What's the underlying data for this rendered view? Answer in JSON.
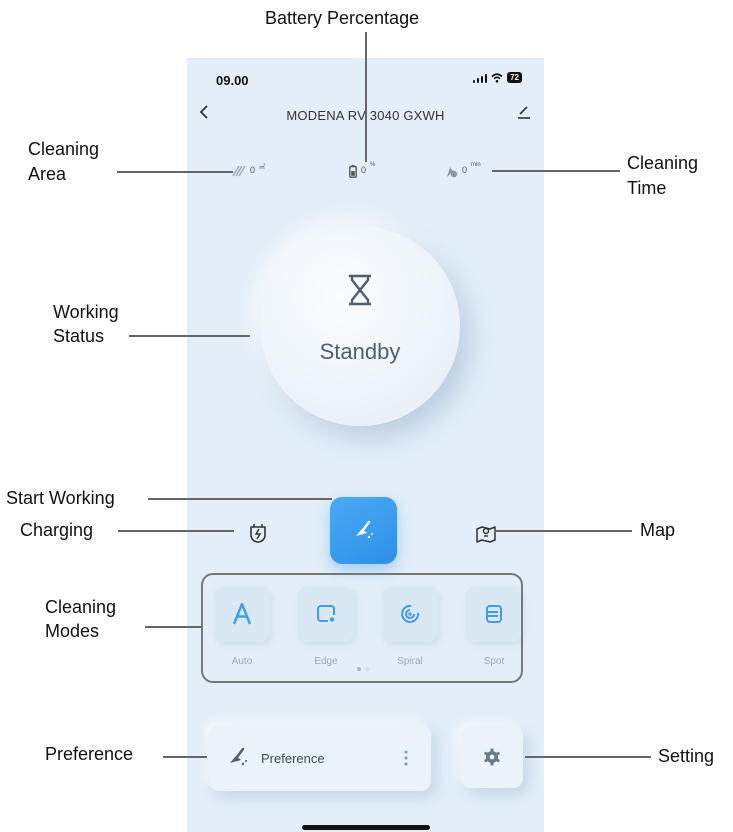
{
  "status_bar": {
    "time": "09.00",
    "battery": "72"
  },
  "nav": {
    "title": "MODENA RV 3040 GXWH",
    "back_icon": "chevron-left-icon",
    "edit_icon": "pencil-icon"
  },
  "stats": {
    "area": {
      "value": "0",
      "unit": "㎡",
      "icon": "area-hatch-icon"
    },
    "battery": {
      "value": "0",
      "unit": "%",
      "icon": "battery-icon"
    },
    "time": {
      "value": "0",
      "unit": "min",
      "icon": "timer-icon"
    }
  },
  "working_status": {
    "text": "Standby",
    "icon": "hourglass-icon"
  },
  "controls": {
    "charging_icon": "charging-dock-icon",
    "start_icon": "broom-icon",
    "map_icon": "map-icon"
  },
  "modes": [
    {
      "label": "Auto",
      "icon": "letter-a-icon"
    },
    {
      "label": "Edge",
      "icon": "edge-icon"
    },
    {
      "label": "Spiral",
      "icon": "spiral-icon"
    },
    {
      "label": "Spot",
      "icon": "spot-icon"
    }
  ],
  "preference": {
    "label": "Preference",
    "icon": "broom-icon",
    "more_icon": "more-vertical-icon"
  },
  "setting": {
    "icon": "gear-icon"
  },
  "annotations": {
    "battery_percentage": "Battery Percentage",
    "cleaning_area_1": "Cleaning",
    "cleaning_area_2": "Area",
    "cleaning_time_1": "Cleaning",
    "cleaning_time_2": "Time",
    "working_status_1": "Working",
    "working_status_2": "Status",
    "start_working": "Start Working",
    "charging": "Charging",
    "map": "Map",
    "cleaning_modes_1": "Cleaning",
    "cleaning_modes_2": "Modes",
    "preference": "Preference",
    "setting": "Setting"
  },
  "colors": {
    "accent": "#3b9cf0",
    "background": "#e3eef8",
    "annotation_line": "#666666"
  }
}
